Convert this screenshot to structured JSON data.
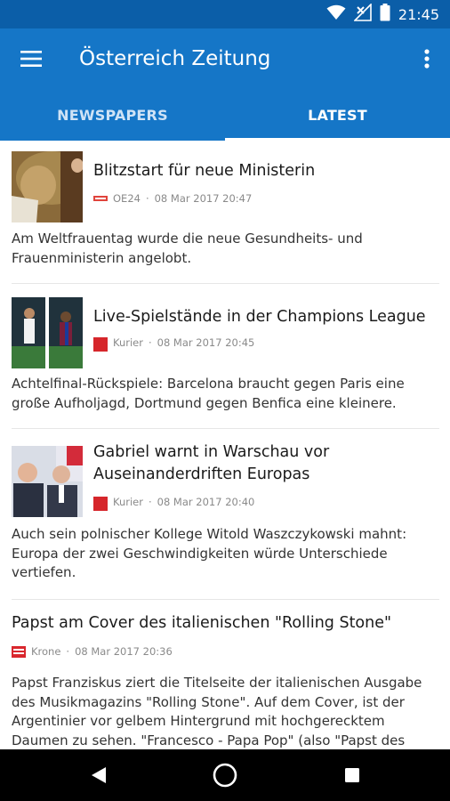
{
  "status_bar": {
    "time": "21:45",
    "icons": [
      "wifi-icon",
      "signal-off-icon",
      "battery-icon"
    ]
  },
  "app_bar": {
    "title": "Österreich Zeitung",
    "menu_icon": "hamburger-menu-icon",
    "more_icon": "more-vert-icon"
  },
  "tabs": [
    {
      "label": "NEWSPAPERS",
      "active": false
    },
    {
      "label": "LATEST",
      "active": true
    }
  ],
  "articles": [
    {
      "headline": "Blitzstart für neue Ministerin",
      "source": "OE24",
      "date": "08 Mar 2017 20:47",
      "summary": "Am Weltfrauentag wurde die neue Gesundheits- und Frauenministerin angelobt."
    },
    {
      "headline": "Live-Spielstände in der Champions League",
      "source": "Kurier",
      "date": "08 Mar 2017 20:45",
      "summary": "Achtelfinal-Rückspiele: Barcelona braucht gegen Paris eine große Aufholjagd, Dortmund gegen Benfica eine kleinere."
    },
    {
      "headline": "Gabriel warnt in Warschau vor Auseinanderdriften Europas",
      "source": "Kurier",
      "date": "08 Mar 2017 20:40",
      "summary": "Auch sein polnischer Kollege Witold Waszczykowski mahnt: Europa der zwei Geschwindigkeiten würde Unterschiede vertiefen."
    },
    {
      "headline": "Papst am Cover des italienischen \"Rolling Stone\"",
      "source": "Krone",
      "date": "08 Mar 2017 20:36",
      "summary": "Papst Franziskus ziert die Titelseite der italienischen Ausgabe des Musikmagazins \"Rolling Stone\". Auf dem Cover, ist der Argentinier vor gelbem Hintergrund mit hochgerecktem Daumen zu sehen. \"Francesco - Papa Pop\" (also \"Papst des Po..."
    }
  ],
  "nav_bar": {
    "back_icon": "back-icon",
    "home_icon": "home-icon",
    "recents_icon": "recents-icon"
  },
  "colors": {
    "status_bar": "#0b5ea8",
    "app_bar": "#1576c7",
    "kurier_red": "#d6262b",
    "oe24_red": "#e0443c",
    "krone_red": "#d9272e"
  }
}
